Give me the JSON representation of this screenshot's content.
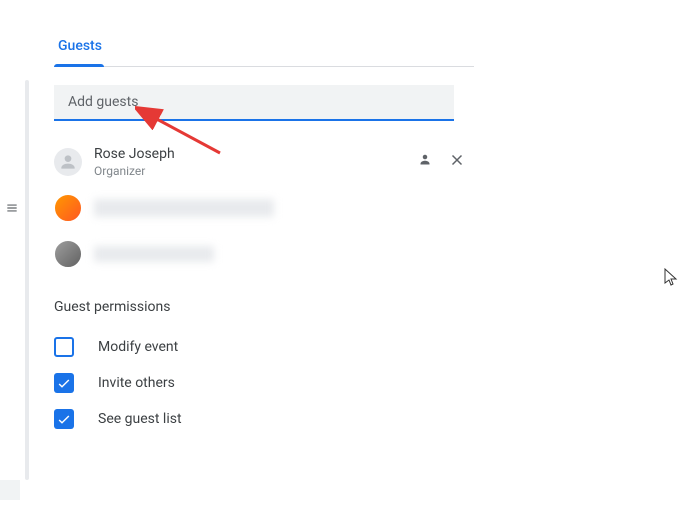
{
  "tab": {
    "label": "Guests"
  },
  "addGuests": {
    "placeholder": "Add guests"
  },
  "organizer": {
    "name": "Rose Joseph",
    "role": "Organizer"
  },
  "permissions": {
    "title": "Guest permissions",
    "items": [
      {
        "label": "Modify event",
        "checked": false
      },
      {
        "label": "Invite others",
        "checked": true
      },
      {
        "label": "See guest list",
        "checked": true
      }
    ]
  }
}
